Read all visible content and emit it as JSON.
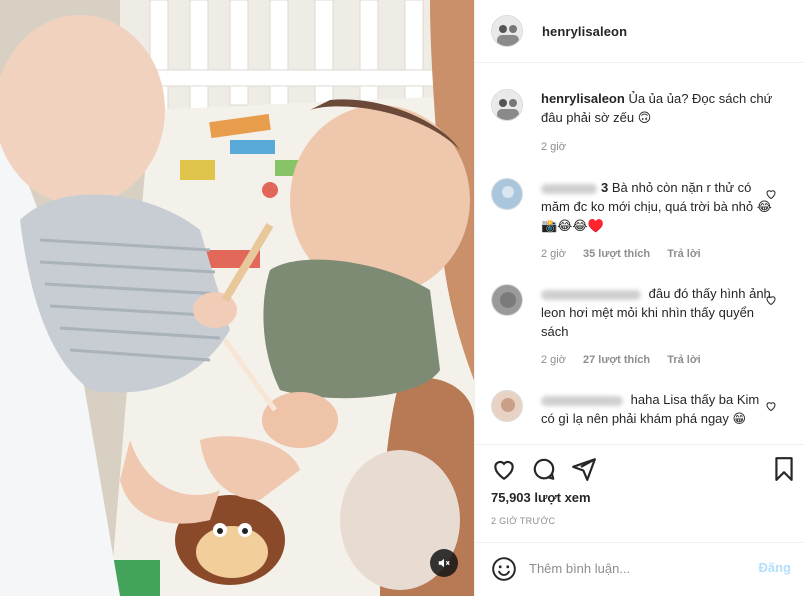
{
  "post": {
    "username": "henrylisaleon",
    "caption": "Ủa ủa ủa? Đọc sách chứ đâu phải sờ zếu 🙃",
    "caption_time": "2 giờ",
    "views": "75,903 lượt xem",
    "time_ago": "2 GIỜ TRƯỚC"
  },
  "comments": [
    {
      "visible_name_tail": "3",
      "text": "Bà nhỏ còn nặn r thử có măm đc ko mới chịu, quá trời bà nhỏ 😂📸😂😂♥️",
      "time": "2 giờ",
      "likes": "35 lượt thích",
      "reply": "Trả lời"
    },
    {
      "visible_name_tail": "",
      "text": "đâu đó thấy hình ảnh leon hơi mệt mỏi khi nhìn thấy quyển sách",
      "time": "2 giờ",
      "likes": "27 lượt thích",
      "reply": "Trả lời"
    },
    {
      "visible_name_tail": "",
      "text": "haha Lisa thấy ba Kim có gì lạ nên phải khám phá ngay 😁",
      "time": "",
      "likes": "",
      "reply": ""
    }
  ],
  "add_comment": {
    "placeholder": "Thêm bình luận...",
    "post_label": "Đăng"
  },
  "icons": {
    "like": "heart-icon",
    "comment": "comment-icon",
    "share": "share-icon",
    "save": "bookmark-icon",
    "emoji": "smiley-icon",
    "mute": "muted-speaker-icon",
    "comment_like": "heart-icon"
  },
  "colors": {
    "text": "#262626",
    "secondary": "#8e8e8e",
    "border": "#efefef",
    "post_button_disabled": "#b2dffc"
  }
}
